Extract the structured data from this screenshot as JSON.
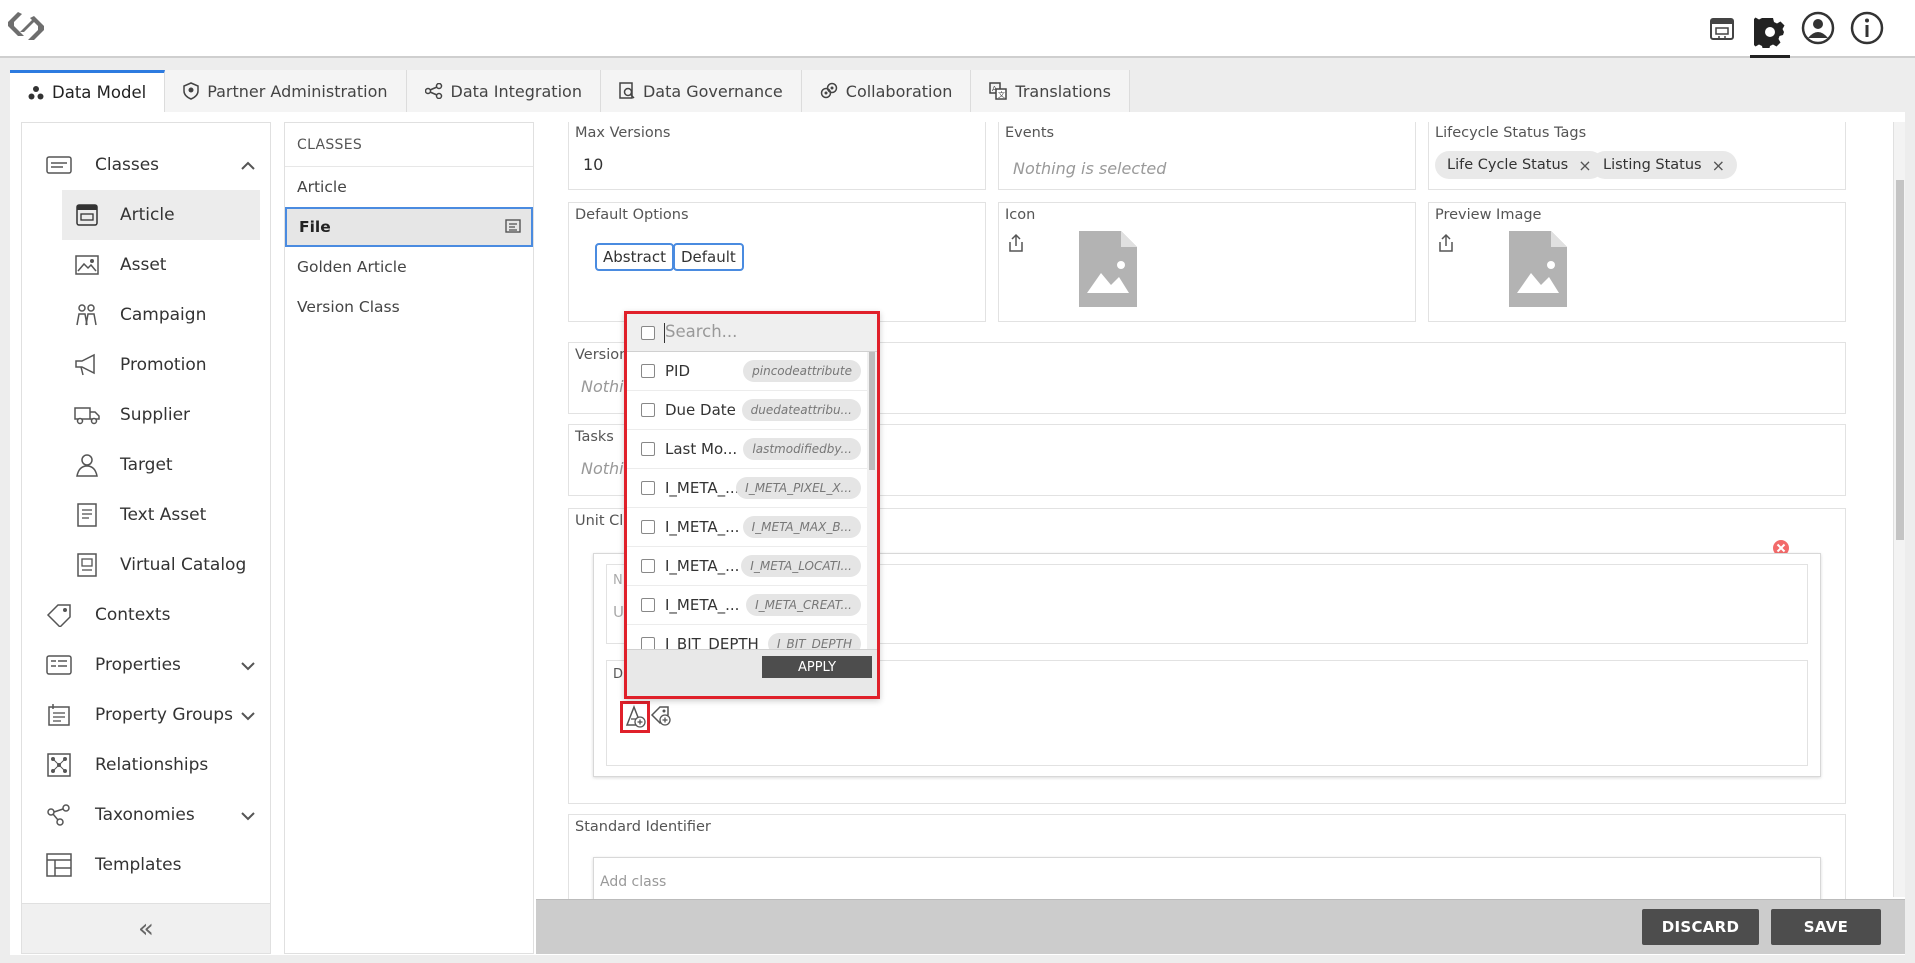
{
  "header": {
    "icons": [
      "logo-icon",
      "catalog-icon",
      "gear-icon",
      "user-icon",
      "info-icon"
    ]
  },
  "tabs": [
    {
      "label": "Data Model",
      "icon": "data-model-icon",
      "active": true
    },
    {
      "label": "Partner Administration",
      "icon": "shield-icon"
    },
    {
      "label": "Data Integration",
      "icon": "share-icon"
    },
    {
      "label": "Data Governance",
      "icon": "governance-icon"
    },
    {
      "label": "Collaboration",
      "icon": "collaboration-icon"
    },
    {
      "label": "Translations",
      "icon": "translate-icon"
    }
  ],
  "sidebar": {
    "classes_label": "Classes",
    "sub_items": [
      "Article",
      "Asset",
      "Campaign",
      "Promotion",
      "Supplier",
      "Target",
      "Text Asset",
      "Virtual Catalog"
    ],
    "items": [
      "Contexts",
      "Properties",
      "Property Groups",
      "Relationships",
      "Taxonomies",
      "Templates"
    ],
    "collapse": "«"
  },
  "classes_panel": {
    "header": "CLASSES",
    "items": [
      "Article",
      "File",
      "Golden Article",
      "Version Class"
    ]
  },
  "detail": {
    "max_versions": {
      "label": "Max Versions",
      "value": "10"
    },
    "events": {
      "label": "Events",
      "placeholder": "Nothing is selected"
    },
    "lifecycle": {
      "label": "Lifecycle Status Tags",
      "tags": [
        "Life Cycle Status",
        "Listing Status"
      ],
      "remove": "×"
    },
    "default_options": {
      "label": "Default Options",
      "buttons": [
        "Abstract",
        "Default"
      ]
    },
    "icon": {
      "label": "Icon"
    },
    "preview_image": {
      "label": "Preview Image"
    },
    "versions": {
      "label": "Version",
      "placeholder": "Nothi"
    },
    "tasks": {
      "label": "Tasks",
      "placeholder": "Nothi"
    },
    "unit_class": {
      "label": "Unit Cla",
      "n_label": "N",
      "u_label": "U",
      "d_label": "D"
    },
    "standard_identifier": {
      "label": "Standard Identifier",
      "add_class": "Add class"
    }
  },
  "actions": {
    "discard": "DISCARD",
    "save": "SAVE"
  },
  "popup": {
    "search_placeholder": "Search...",
    "rows": [
      {
        "name": "PID",
        "id": "pincodeattribute"
      },
      {
        "name": "Due Date",
        "id": "duedateattribu..."
      },
      {
        "name": "Last Mo...",
        "id": "lastmodifiedby..."
      },
      {
        "name": "I_META_...",
        "id": "I_META_PIXEL_X..."
      },
      {
        "name": "I_META_...",
        "id": "I_META_MAX_B..."
      },
      {
        "name": "I_META_...",
        "id": "I_META_LOCATI..."
      },
      {
        "name": "I_META_...",
        "id": "I_META_CREAT..."
      },
      {
        "name": "I_BIT_DEPTH",
        "id": "I_BIT_DEPTH"
      }
    ],
    "apply": "APPLY"
  }
}
